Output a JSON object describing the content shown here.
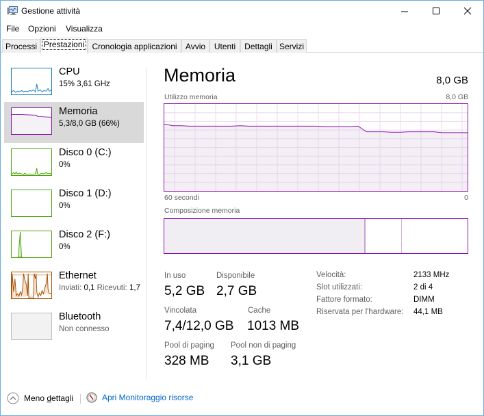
{
  "window": {
    "title": "Gestione attività",
    "controls": {
      "minimize": "minimize",
      "maximize": "maximize",
      "close": "close"
    }
  },
  "menu": [
    "File",
    "Opzioni",
    "Visualizza"
  ],
  "tabs": [
    {
      "label": "Processi",
      "active": false
    },
    {
      "label": "Prestazioni",
      "active": true
    },
    {
      "label": "Cronologia applicazioni",
      "active": false
    },
    {
      "label": "Avvio",
      "active": false
    },
    {
      "label": "Utenti",
      "active": false
    },
    {
      "label": "Dettagli",
      "active": false
    },
    {
      "label": "Servizi",
      "active": false
    }
  ],
  "sidebar": {
    "items": [
      {
        "name": "CPU",
        "sub": "15% 3,61 GHz",
        "color": "#1779ba",
        "active": false
      },
      {
        "name": "Memoria",
        "sub": "5,3/8,0 GB (66%)",
        "color": "#8b12ae",
        "active": true
      },
      {
        "name": "Disco 0 (C:)",
        "sub": "0%",
        "color": "#4da60c",
        "active": false
      },
      {
        "name": "Disco 1 (D:)",
        "sub": "0%",
        "color": "#4da60c",
        "active": false
      },
      {
        "name": "Disco 2 (F:)",
        "sub": "0%",
        "color": "#4da60c",
        "active": false
      },
      {
        "name": "Ethernet",
        "sub_label1": "Inviati:",
        "sub_value1": "0,1",
        "sub_label2": "Ricevuti:",
        "sub_value2": "1,7",
        "color": "#a74f01",
        "active": false
      },
      {
        "name": "Bluetooth",
        "sub": "Non connesso",
        "color": "#bcbcbc",
        "active": false
      }
    ]
  },
  "main": {
    "title": "Memoria",
    "total": "8,0 GB",
    "graph": {
      "label": "Utilizzo memoria",
      "max_label": "8,0 GB",
      "x_left": "60 secondi",
      "x_right": "0",
      "usage_fraction_series": [
        0.77,
        0.75,
        0.75,
        0.745,
        0.745,
        0.745,
        0.745,
        0.745,
        0.745,
        0.75,
        0.745,
        0.745,
        0.745,
        0.745,
        0.745,
        0.745,
        0.745,
        0.745,
        0.745,
        0.74,
        0.74,
        0.74,
        0.74,
        0.745,
        0.68,
        0.68,
        0.68,
        0.675,
        0.675,
        0.68,
        0.68,
        0.68,
        0.68,
        0.67,
        0.67,
        0.67,
        0.67
      ]
    },
    "composition": {
      "label": "Composizione memoria",
      "in_use_fraction": 0.66,
      "modified_fraction": 0.005,
      "standby_fraction": 0.12,
      "free_fraction": 0.215
    },
    "stats": {
      "in_use": {
        "label": "In uso",
        "value": "5,2 GB"
      },
      "available": {
        "label": "Disponibile",
        "value": "2,7 GB"
      },
      "committed": {
        "label": "Vincolata",
        "value": "7,4/12,0 GB"
      },
      "cached": {
        "label": "Cache",
        "value": "1013 MB"
      },
      "paged_pool": {
        "label": "Pool di paging",
        "value": "328 MB"
      },
      "nonpaged_pool": {
        "label": "Pool non di paging",
        "value": "3,1 GB"
      }
    },
    "details": [
      {
        "label": "Velocità:",
        "value": "2133 MHz"
      },
      {
        "label": "Slot utilizzati:",
        "value": "2 di 4"
      },
      {
        "label": "Fattore formato:",
        "value": "DIMM"
      },
      {
        "label": "Riservata per l'hardware:",
        "value": "44,1 MB"
      }
    ]
  },
  "footer": {
    "less_details_pre": "Meno ",
    "less_details_ul": "d",
    "less_details_post": "ettagli",
    "resource_monitor": "Apri Monitoraggio risorse"
  }
}
